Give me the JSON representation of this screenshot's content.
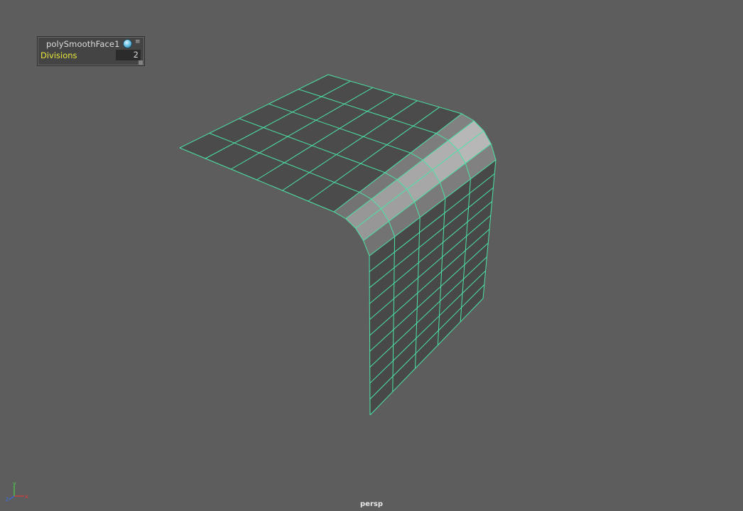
{
  "hud": {
    "node_name": "polySmoothFace1",
    "attribute_label": "Divisions",
    "attribute_value": "2",
    "icons": [
      "node-sphere-icon",
      "menu-icon"
    ]
  },
  "viewport": {
    "camera": "persp",
    "wire_color": "#4be3a6",
    "background_color": "#5d5d5d"
  },
  "axis_indicator": {
    "labels": [
      "y",
      "x",
      "z"
    ],
    "colors": {
      "x": "#e03a3a",
      "y": "#4ad14a",
      "z": "#3a6ae0"
    }
  }
}
